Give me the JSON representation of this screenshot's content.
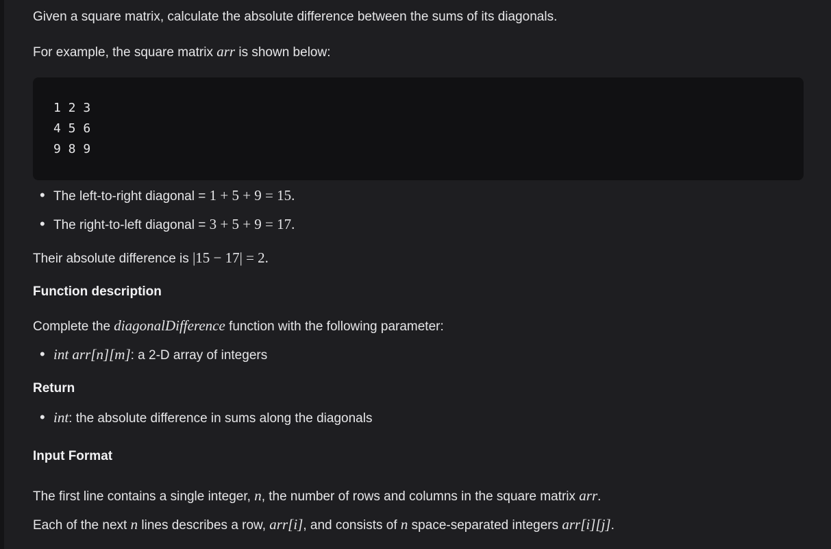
{
  "intro": "Given a square matrix, calculate the absolute difference between the sums of its diagonals.",
  "example_prefix": "For example, the square matrix ",
  "example_var": "arr",
  "example_suffix": " is shown below:",
  "matrix_rows": [
    "1 2 3",
    "4 5 6",
    "9 8 9"
  ],
  "bullets_diag": [
    {
      "label": "The left-to-right diagonal = ",
      "math": "1 + 5 + 9 = 15."
    },
    {
      "label": "The right-to-left diagonal = ",
      "math": "3 + 5 + 9 = 17."
    }
  ],
  "abs_diff_prefix": "Their absolute difference is ",
  "abs_diff_math": "|15 − 17| = 2.",
  "function_heading": "Function description",
  "complete_prefix": "Complete the ",
  "complete_fn": "diagonalDifference",
  "complete_suffix": " function with the following parameter:",
  "param_type": "int",
  "param_name": "arr[n][m]",
  "param_desc": ": a 2-D array of integers",
  "return_heading": "Return",
  "return_type": "int",
  "return_desc": ": the absolute difference in sums along the diagonals",
  "input_heading": "Input Format",
  "input_line1_a": "The first line contains a single integer, ",
  "input_line1_var": "n",
  "input_line1_b": ", the number of rows and columns in the square matrix ",
  "input_line1_var2": "arr",
  "input_line1_c": ".",
  "input_line2_a": "Each of the next ",
  "input_line2_var": "n",
  "input_line2_b": " lines describes a row, ",
  "input_line2_var2": "arr[i]",
  "input_line2_c": ", and consists of ",
  "input_line2_var3": "n",
  "input_line2_d": " space-separated integers ",
  "input_line2_var4": "arr[i][j]",
  "input_line2_e": "."
}
